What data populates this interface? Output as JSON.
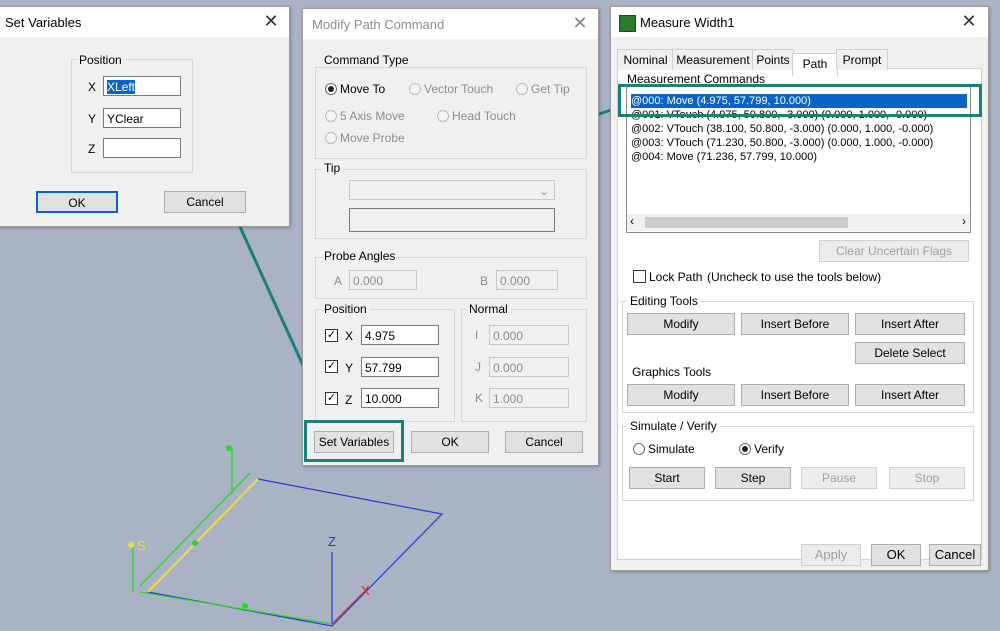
{
  "set_variables": {
    "title": "Set Variables",
    "group": "Position",
    "x_label": "X",
    "x_value": "XLeft",
    "y_label": "Y",
    "y_value": "YClear",
    "z_label": "Z",
    "z_value": "",
    "ok": "OK",
    "cancel": "Cancel"
  },
  "modify_path": {
    "title": "Modify Path Command",
    "command_type": "Command Type",
    "options": [
      "Move To",
      "Vector Touch",
      "Get Tip",
      "5 Axis Move",
      "Head Touch",
      "Move Probe"
    ],
    "selected_option": "Move To",
    "tip": "Tip",
    "probe_angles": "Probe Angles",
    "a_label": "A",
    "a_value": "0.000",
    "b_label": "B",
    "b_value": "0.000",
    "position": "Position",
    "x_label": "X",
    "x_value": "4.975",
    "y_label": "Y",
    "y_value": "57.799",
    "z_label": "Z",
    "z_value": "10.000",
    "normal": "Normal",
    "i_label": "I",
    "i_value": "0.000",
    "j_label": "J",
    "j_value": "0.000",
    "k_label": "K",
    "k_value": "1.000",
    "set_variables_button": "Set Variables",
    "ok": "OK",
    "cancel": "Cancel"
  },
  "measure": {
    "title": "Measure Width1",
    "tabs": [
      "Nominal",
      "Measurement",
      "Points",
      "Path",
      "Prompt"
    ],
    "active_tab": "Path",
    "list_label": "Measurement Commands",
    "commands": [
      "@000: Move (4.975, 57.799, 10.000)",
      "@001: VTouch (4.975, 50.800, -3.000) (0.000, 1.000, -0.000)",
      "@002: VTouch (38.100, 50.800, -3.000) (0.000, 1.000, -0.000)",
      "@003: VTouch (71.230, 50.800, -3.000) (0.000, 1.000, -0.000)",
      "@004: Move (71.236, 57.799, 10.000)"
    ],
    "clear_flags": "Clear Uncertain Flags",
    "lock_path": "Lock Path",
    "lock_hint": "(Uncheck to use the tools below)",
    "editing_tools": "Editing Tools",
    "graphics_tools": "Graphics Tools",
    "modify": "Modify",
    "insert_before": "Insert Before",
    "insert_after": "Insert After",
    "delete_select": "Delete Select",
    "simulate_verify": "Simulate / Verify",
    "simulate": "Simulate",
    "verify": "Verify",
    "start": "Start",
    "step": "Step",
    "pause": "Pause",
    "stop": "Stop",
    "apply": "Apply",
    "ok": "OK",
    "cancel": "Cancel"
  },
  "viewport": {
    "axis_s": "S",
    "axis_z": "Z",
    "axis_x": "X",
    "accent_color": "#1b8076"
  }
}
